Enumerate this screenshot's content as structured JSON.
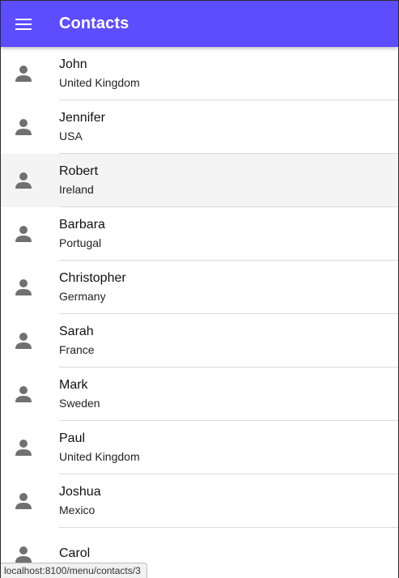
{
  "theme": {
    "accent": "#5c4dff",
    "icon_color": "#707070"
  },
  "header": {
    "title": "Contacts",
    "menu_icon": "menu-icon"
  },
  "contacts": [
    {
      "name": "John",
      "country": "United Kingdom"
    },
    {
      "name": "Jennifer",
      "country": "USA"
    },
    {
      "name": "Robert",
      "country": "Ireland"
    },
    {
      "name": "Barbara",
      "country": "Portugal"
    },
    {
      "name": "Christopher",
      "country": "Germany"
    },
    {
      "name": "Sarah",
      "country": "France"
    },
    {
      "name": "Mark",
      "country": "Sweden"
    },
    {
      "name": "Paul",
      "country": "United Kingdom"
    },
    {
      "name": "Joshua",
      "country": "Mexico"
    },
    {
      "name": "Carol",
      "country": ""
    }
  ],
  "status_bar": {
    "url": "localhost:8100/menu/contacts/3"
  }
}
